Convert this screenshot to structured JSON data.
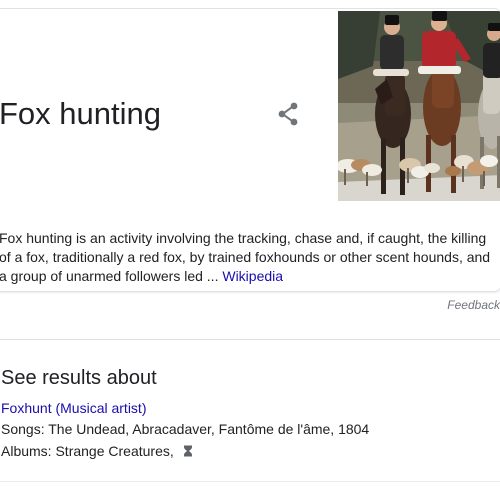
{
  "knowledge_panel": {
    "title": "Fox hunting",
    "description_text": "Fox hunting is an activity involving the tracking, chase and, if caught, the killing of a fox, traditionally a red fox, by trained foxhounds or other scent hounds, and a group of unarmed followers led ",
    "ellipsis": "...",
    "source_link": "Wikipedia",
    "feedback_label": "Feedback",
    "share_icon": "share-icon",
    "image_subject": "fox-hunting-photo"
  },
  "see_results_about": {
    "heading": "See results about",
    "entity_link": "Foxhunt (Musical artist)",
    "songs_label": "Songs: ",
    "songs_value": "The Undead, Abracadaver, Fantôme de l'âme, 1804",
    "albums_label": "Albums: ",
    "albums_value": "Strange Creatures, ",
    "albums_more_icon": "hourglass-icon"
  },
  "colors": {
    "link_blue": "#1a0dab",
    "text_dark": "#202124",
    "muted_gray": "#70757a",
    "border_gray": "#dfe1e5",
    "hunter_red": "#b3262b"
  }
}
